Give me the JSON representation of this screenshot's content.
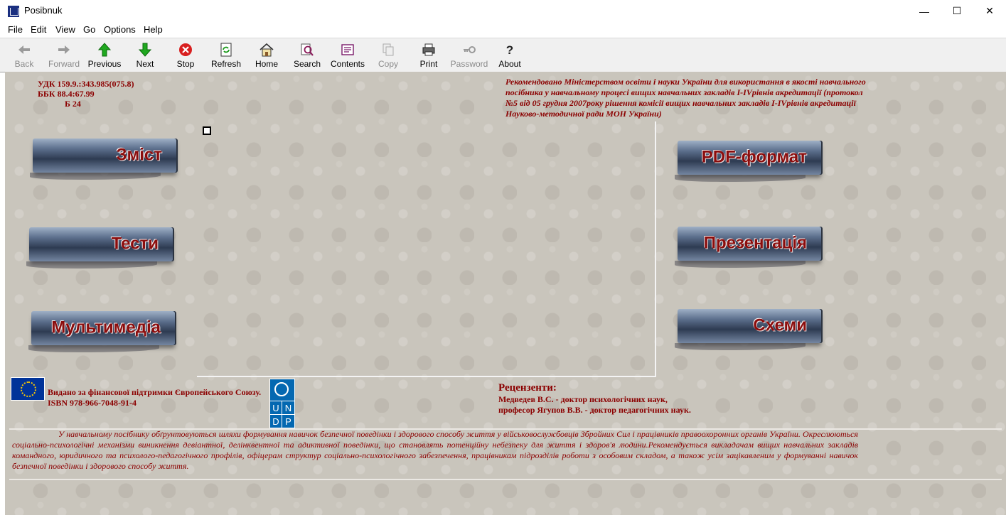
{
  "window": {
    "title": "Posibnuk"
  },
  "menu": [
    "File",
    "Edit",
    "View",
    "Go",
    "Options",
    "Help"
  ],
  "toolbar": [
    {
      "label": "Back",
      "icon": "back-arrow-icon",
      "enabled": false
    },
    {
      "label": "Forward",
      "icon": "forward-arrow-icon",
      "enabled": false
    },
    {
      "label": "Previous",
      "icon": "up-arrow-icon",
      "enabled": true
    },
    {
      "label": "Next",
      "icon": "down-arrow-icon",
      "enabled": true
    },
    {
      "label": "Stop",
      "icon": "stop-icon",
      "enabled": true
    },
    {
      "label": "Refresh",
      "icon": "refresh-icon",
      "enabled": true
    },
    {
      "label": "Home",
      "icon": "home-icon",
      "enabled": true
    },
    {
      "label": "Search",
      "icon": "search-icon",
      "enabled": true
    },
    {
      "label": "Contents",
      "icon": "contents-icon",
      "enabled": true
    },
    {
      "label": "Copy",
      "icon": "copy-icon",
      "enabled": false
    },
    {
      "label": "Print",
      "icon": "print-icon",
      "enabled": true
    },
    {
      "label": "Password",
      "icon": "key-icon",
      "enabled": false
    },
    {
      "label": "About",
      "icon": "question-icon",
      "enabled": true
    }
  ],
  "page": {
    "udk": [
      "УДК 159.9.:343.985(075.8)",
      "ББК 88.4:67.99",
      "Б 24"
    ],
    "recommendation": "Рекомендовано Міністерством освіти і науки України для використання в якості навчального посібника у навчальному процесі вищих навчальних закладів І-ІVрівнів акредитації (протокол №5 від 05 грудня 2007року рішення комісії вищих навчальних закладів І-IVрівнів акредитації Науково-методичної ради МОН України)",
    "left_buttons": [
      "Зміст",
      "Тести",
      "Мультимедіа"
    ],
    "right_buttons": [
      "PDF-формат",
      "Презентація",
      "Схеми"
    ],
    "funding": [
      "Видано за фінансової підтримки Європейського Союзу.",
      "ISBN 978-966-7048-91-4"
    ],
    "undp_letters": [
      "U",
      "N",
      "D",
      "P"
    ],
    "reviewers": {
      "heading": "Рецензенти:",
      "lines": [
        "Медведев В.С. - доктор психологічних наук,",
        "професор Ягупов В.В. - доктор педагогічних наук."
      ]
    },
    "annotation": "У навчальному посібнику обґрунтовуються шляхи формування навичок безпечної поведінки і здорового способу життя у військовослужбовців Збройних Сил і працівників правоохоронних органів України. Окреслюються соціально-психологічні механізми виникнення девіантної, делінквентної та адиктивної поведінки, що становлять потенційну небезпеку для життя і здоров'я людини.Рекомендується викладачам вищих навчальних закладів командного, юридичного та психолого-педагогічного профілів, офіцерам структур соціально-психологічного забезпечення, працівникам підрозділів роботи з особовим складом, а також усім зацікавленим у формуванні навичок безпечної поведінки і здорового способу життя."
  },
  "colors": {
    "text_dark_red": "#8b0000",
    "background": "#c9c5bc",
    "button_blue": "#5c6f8c"
  }
}
